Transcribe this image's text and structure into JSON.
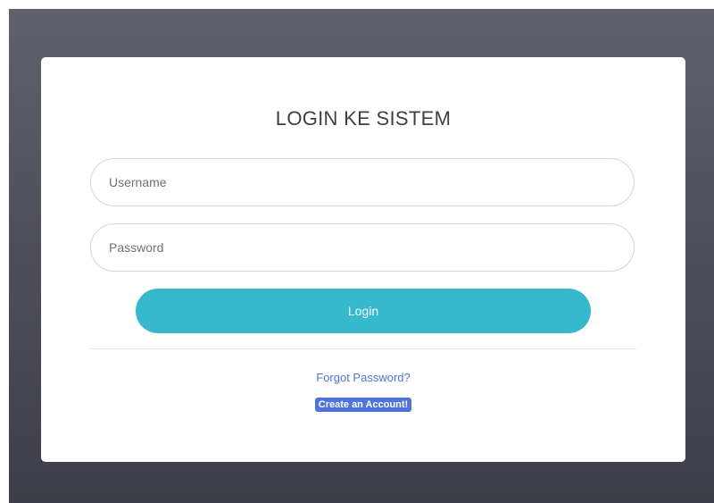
{
  "login": {
    "title": "LOGIN KE SISTEM",
    "username": {
      "placeholder": "Username",
      "value": ""
    },
    "password": {
      "placeholder": "Password",
      "value": ""
    },
    "login_label": "Login",
    "forgot_label": "Forgot Password?",
    "create_label": "Create an Account!"
  },
  "colors": {
    "backdrop": "#4b4c56",
    "card": "#ffffff",
    "login_button": "#36b9cc",
    "link": "#4e73df",
    "create_badge": "#4e73df"
  }
}
